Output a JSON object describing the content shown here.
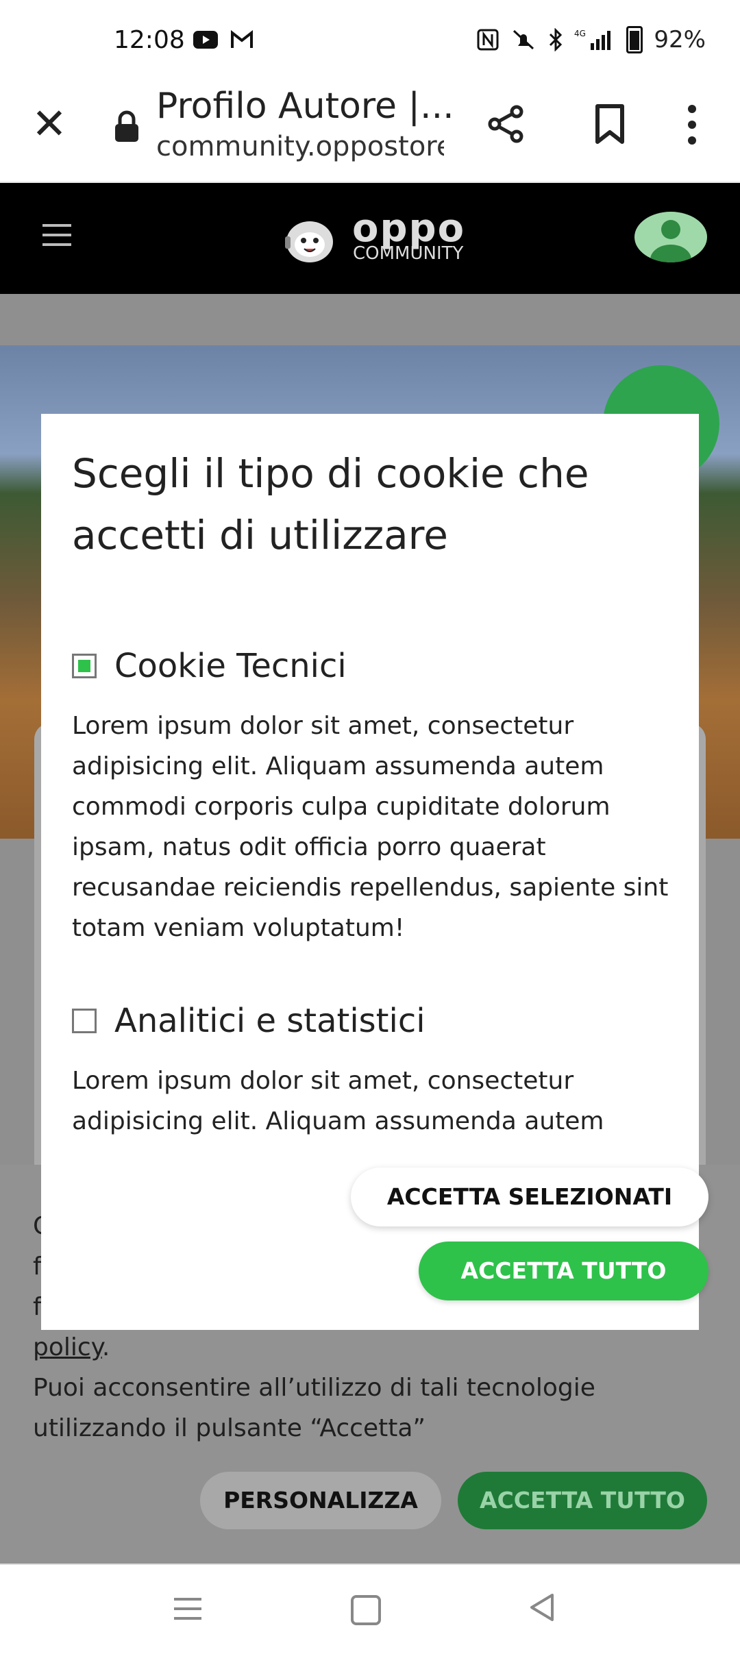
{
  "status_bar": {
    "time": "12:08",
    "battery": "92%",
    "left_icons": [
      "youtube-icon",
      "gmail-icon"
    ],
    "right_icons": [
      "nfc-icon",
      "mute-icon",
      "bluetooth-icon",
      "signal-4g-icon",
      "battery-icon"
    ]
  },
  "browser": {
    "page_title": "Profilo Autore |...",
    "url": "community.oppostore.it"
  },
  "site_header": {
    "logo_text": "oppo",
    "logo_subtext": "COMMUNITY"
  },
  "consent_bar": {
    "lines": [
      "C",
      "f",
      "f"
    ],
    "policy_link": "policy",
    "policy_suffix": ".",
    "line_4": "Puoi acconsentire all’utilizzo di tali tecnologie",
    "line_5": "utilizzando il pulsante “Accetta”",
    "personalize_label": "PERSONALIZZA",
    "accept_all_label": "ACCETTA TUTTO"
  },
  "modal": {
    "title": "Scegli il tipo di cookie che accetti di utilizzare",
    "options": [
      {
        "label": "Cookie Tecnici",
        "checked": true,
        "lines": [
          "Lorem ipsum dolor sit amet, consectetur",
          "adipisicing elit. Aliquam assumenda autem",
          "commodi corporis culpa cupiditate dolorum",
          "ipsam, natus odit officia porro quaerat",
          "recusandae reiciendis repellendus, sapiente sint",
          "totam veniam voluptatum!"
        ]
      },
      {
        "label": "Analitici e statistici",
        "checked": false,
        "lines": [
          "Lorem ipsum dolor sit amet, consectetur",
          "adipisicing elit. Aliquam assumenda autem"
        ]
      }
    ],
    "accept_selected_label": "ACCETTA SELEZIONATI",
    "accept_all_label": "ACCETTA TUTTO"
  },
  "colors": {
    "accent_green": "#2ec24a",
    "header_black": "#000000",
    "overlay_gray": "#8f8f8f"
  }
}
